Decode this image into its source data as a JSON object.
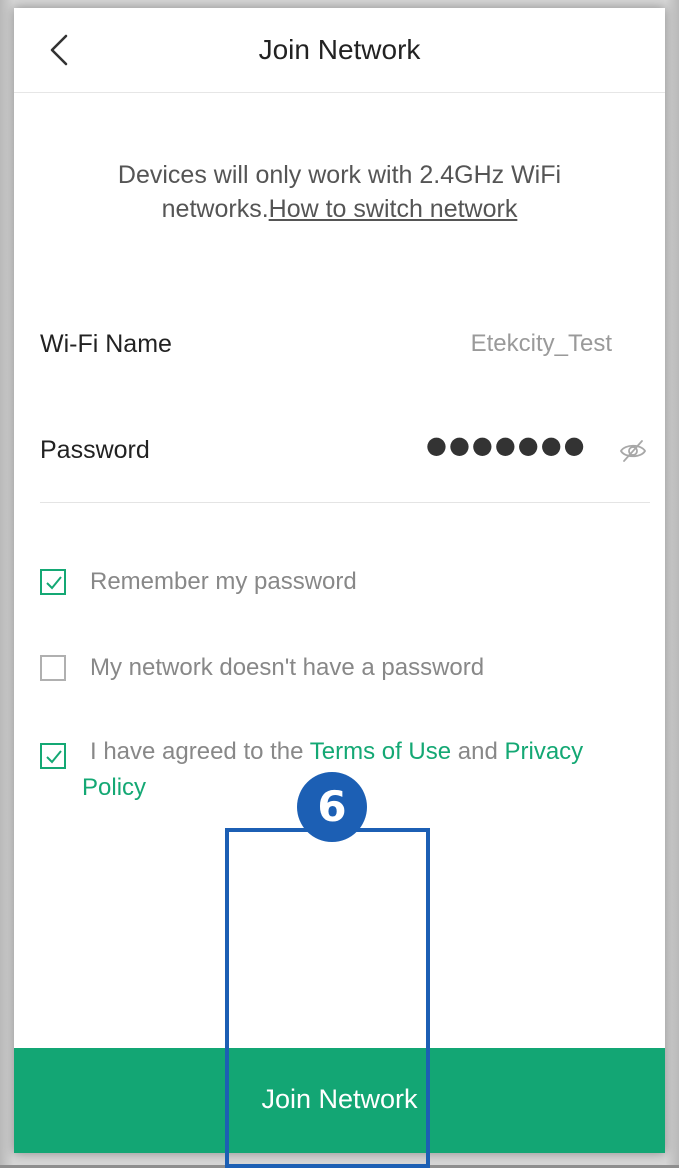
{
  "header": {
    "title": "Join Network",
    "back_icon": "chevron-left-icon"
  },
  "notice": {
    "text": "Devices will only work with 2.4GHz WiFi networks.",
    "link": "How to switch network"
  },
  "form": {
    "wifi_label": "Wi-Fi Name",
    "wifi_value": "Etekcity_Test",
    "password_label": "Password",
    "password_value": "●●●●●●●●",
    "eye_icon": "eye-slash-icon"
  },
  "options": {
    "remember_label": "Remember my password",
    "remember_checked": true,
    "no_password_label": "My network doesn't have a password",
    "no_password_checked": false,
    "terms_prefix": "I have agreed to the",
    "terms_link": "Terms of Use",
    "terms_and": "and",
    "privacy_link_part1": "Privacy",
    "privacy_link_part2": "Policy",
    "terms_checked": true
  },
  "footer": {
    "join_label": "Join Network"
  },
  "annotation": {
    "step_number": "6"
  },
  "colors": {
    "accent_green": "#13a674",
    "annotation_blue": "#1c5fb4"
  }
}
